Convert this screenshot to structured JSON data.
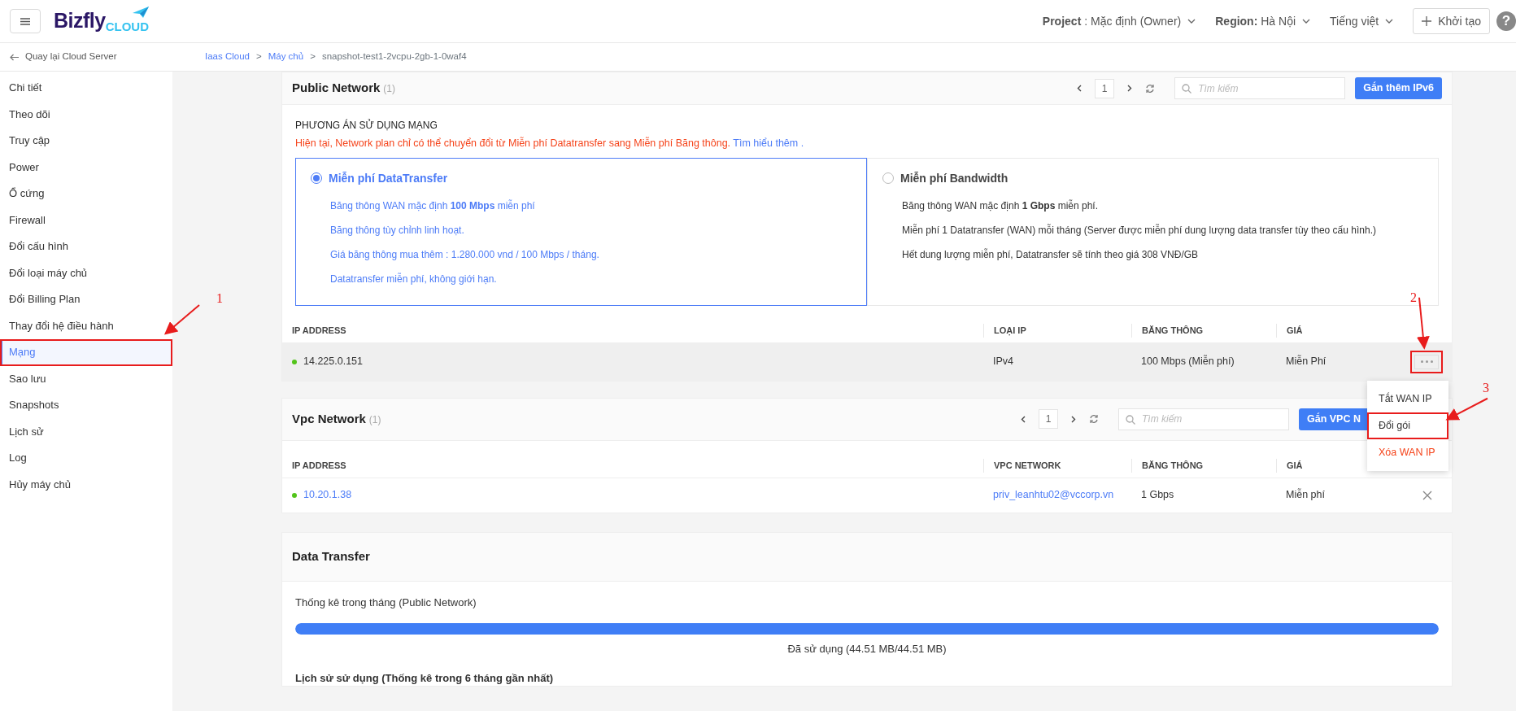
{
  "topbar": {
    "brand": {
      "name": "Bizfly",
      "suffix": "CLOUD"
    },
    "project": {
      "label": "Project",
      "value": ": Mặc định (Owner)"
    },
    "region": {
      "label": "Region:",
      "value": "Hà Nội"
    },
    "language": "Tiếng việt",
    "create_button": "Khởi tạo",
    "help": "?"
  },
  "back_link": "Quay lại Cloud Server",
  "breadcrumb": {
    "separator": ">",
    "items": [
      {
        "label": "Iaas Cloud",
        "link": true
      },
      {
        "label": "Máy chủ",
        "link": true
      },
      {
        "label": "snapshot-test1-2vcpu-2gb-1-0waf4",
        "link": false
      }
    ]
  },
  "sidebar": {
    "items": [
      {
        "label": "Chi tiết",
        "selected": false
      },
      {
        "label": "Theo dõi",
        "selected": false
      },
      {
        "label": "Truy cập",
        "selected": false
      },
      {
        "label": "Power",
        "selected": false
      },
      {
        "label": "Ổ cứng",
        "selected": false
      },
      {
        "label": "Firewall",
        "selected": false
      },
      {
        "label": "Đổi cấu hình",
        "selected": false
      },
      {
        "label": "Đổi loại máy chủ",
        "selected": false
      },
      {
        "label": "Đổi Billing Plan",
        "selected": false
      },
      {
        "label": "Thay đổi hệ điều hành",
        "selected": false
      },
      {
        "label": "Mạng",
        "selected": true
      },
      {
        "label": "Sao lưu",
        "selected": false
      },
      {
        "label": "Snapshots",
        "selected": false
      },
      {
        "label": "Lịch sử",
        "selected": false
      },
      {
        "label": "Log",
        "selected": false
      },
      {
        "label": "Hủy máy chủ",
        "selected": false
      }
    ]
  },
  "public_network": {
    "title": "Public Network",
    "count": "(1)",
    "page": "1",
    "search": {
      "placeholder": "Tìm kiếm"
    },
    "action_button": "Gắn thêm IPv6",
    "plan_heading": "PHƯƠNG ÁN SỬ DỤNG MẠNG",
    "notice": {
      "text": "Hiện tại, Network plan chỉ có thể chuyển đổi từ Miễn phí Datatransfer sang Miễn phí Băng thông.",
      "link": "Tìm hiểu thêm ."
    },
    "plans": [
      {
        "title": "Miễn phí DataTransfer",
        "selected": true,
        "lines": [
          "Băng thông WAN mặc định **100 Mbps** miễn phí",
          "Băng thông tùy chỉnh linh hoạt.",
          "Giá băng thông mua thêm : 1.280.000 vnd / 100 Mbps / tháng.",
          "Datatransfer miễn phí, không giới hạn."
        ]
      },
      {
        "title": "Miễn phí Bandwidth",
        "selected": false,
        "lines": [
          "Băng thông WAN mặc định **1 Gbps** miễn phí.",
          "Miễn phí 1 Datatransfer (WAN) mỗi tháng (Server được miễn phí dung lượng data transfer tùy theo cấu hình.)",
          "Hết dung lượng miễn phí, Datatransfer sẽ tính theo giá 308 VNĐ/GB"
        ]
      }
    ],
    "table": {
      "columns": [
        "IP ADDRESS",
        "LOẠI IP",
        "BĂNG THÔNG",
        "GIÁ"
      ],
      "rows": [
        {
          "highlighted": true,
          "cells": [
            "14.225.0.151",
            "IPv4",
            "100 Mbps (Miễn phí)",
            "Miễn Phí"
          ],
          "menu_open": true
        }
      ]
    },
    "row_menu": [
      {
        "label": "Tắt WAN IP",
        "kind": "normal"
      },
      {
        "label": "Đổi gói",
        "kind": "normal"
      },
      {
        "label": "Xóa WAN IP",
        "kind": "danger"
      }
    ]
  },
  "vpc_network": {
    "title": "Vpc Network",
    "count": "(1)",
    "page": "1",
    "search": {
      "placeholder": "Tìm kiếm"
    },
    "action_button": "Gắn VPC N",
    "table": {
      "columns": [
        "IP ADDRESS",
        "VPC NETWORK",
        "BĂNG THÔNG",
        "GIÁ"
      ],
      "rows": [
        {
          "cells": [
            "10.20.1.38",
            "priv_leanhtu02@vccorp.vn",
            "1 Gbps",
            "Miễn phí"
          ]
        }
      ]
    }
  },
  "data_transfer": {
    "title": "Data Transfer",
    "stats_label": "Thống kê trong tháng (Public Network)",
    "level": 1,
    "usage": "Đã sử dụng (44.51 MB/44.51 MB)",
    "history_title": "Lịch sử sử dụng (Thống kê trong 6 tháng gần nhất)"
  },
  "annotations": [
    {
      "number": "1"
    },
    {
      "number": "2"
    },
    {
      "number": "3"
    }
  ]
}
